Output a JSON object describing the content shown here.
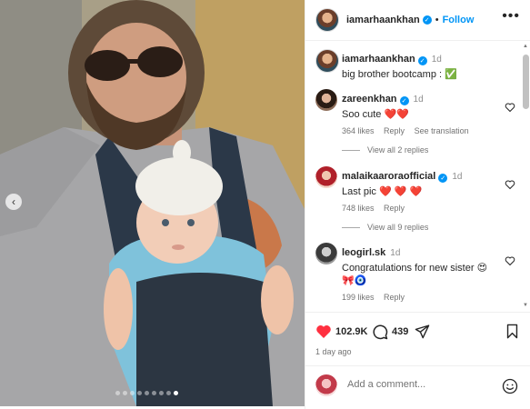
{
  "post": {
    "username": "iamarhaankhan",
    "follow_label": "Follow",
    "more_label": "•••",
    "caption": "big brother bootcamp : ✅",
    "caption_time": "1d",
    "likes": "102.9K",
    "comments_count": "439",
    "posted_ago": "1 day ago",
    "image": {
      "dots_total": 9,
      "active_dot": 8,
      "prev_label": "‹"
    }
  },
  "comments": [
    {
      "username": "zareenkhan",
      "verified": true,
      "time": "1d",
      "text": "Soo cute ❤️❤️",
      "likes": "364 likes",
      "reply": "Reply",
      "extra": "See translation",
      "view_replies": "View all 2 replies"
    },
    {
      "username": "malaikaaroraofficial",
      "verified": true,
      "time": "1d",
      "text": "Last pic ❤️ ❤️ ❤️",
      "likes": "748 likes",
      "reply": "Reply",
      "view_replies": "View all 9 replies"
    },
    {
      "username": "leogirl.sk",
      "verified": false,
      "time": "1d",
      "text": "Congratulations for new sister 😍🎀🧿",
      "likes": "199 likes",
      "reply": "Reply"
    }
  ],
  "add_comment": {
    "placeholder": "Add a comment..."
  },
  "icons": {
    "like": "heart-filled-icon",
    "comment": "comment-bubble-icon",
    "share": "paper-plane-icon",
    "save": "bookmark-icon",
    "emoji": "smiley-icon"
  },
  "colors": {
    "accent": "#0095f6",
    "like": "#ff3040"
  }
}
